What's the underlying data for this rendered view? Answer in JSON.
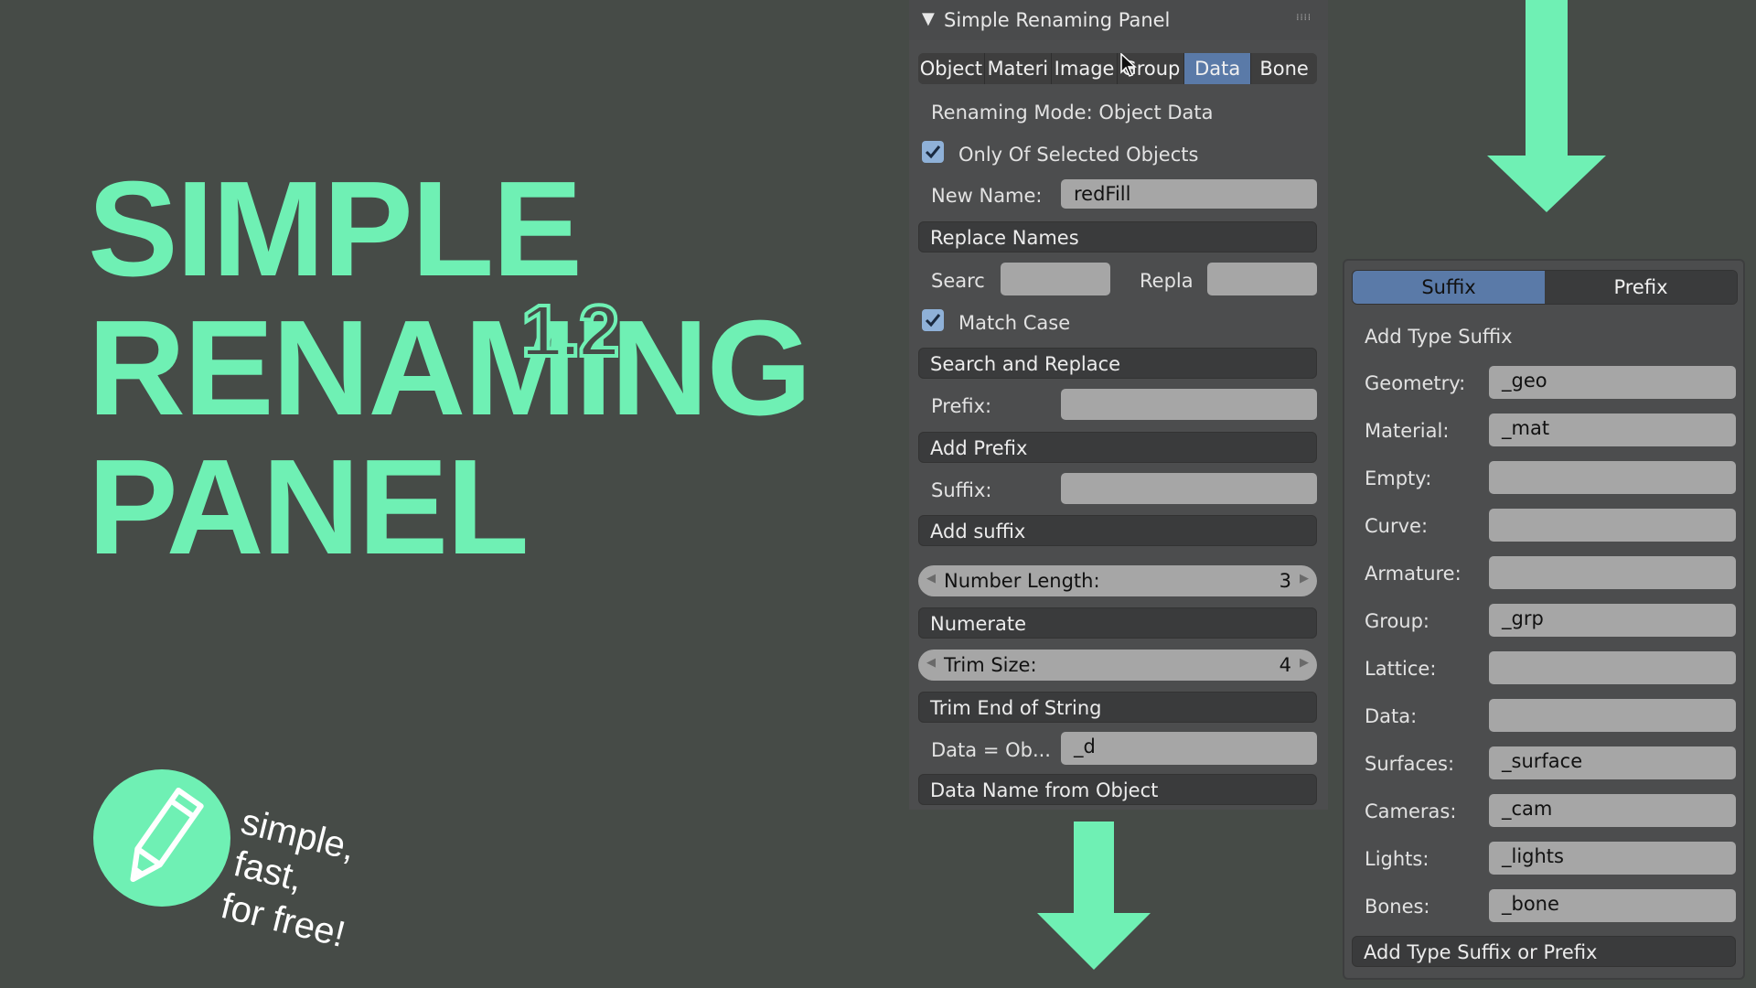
{
  "hero": {
    "line1": "SIMPLE",
    "line2": "RENAMING",
    "line3": "PANEL",
    "version": "1.2"
  },
  "logo": {
    "icon": "pencil-icon",
    "tagline1": "simple,",
    "tagline2": "fast,",
    "tagline3": "for free!"
  },
  "colors": {
    "accent": "#6ff0b4",
    "background": "#464b47",
    "panel": "#4c4d4e",
    "active_tab": "#5a7aa8",
    "field": "#a6a6a6",
    "button": "#3a3b3c"
  },
  "main_panel": {
    "title": "Simple Renaming Panel",
    "tabs": [
      {
        "label": "Object",
        "active": false
      },
      {
        "label": "Materi",
        "active": false
      },
      {
        "label": "Image",
        "active": false
      },
      {
        "label": "Group",
        "active": false
      },
      {
        "label": "Data",
        "active": true
      },
      {
        "label": "Bone",
        "active": false
      }
    ],
    "renaming_mode": "Renaming Mode: Object Data",
    "only_selected_label": "Only Of Selected Objects",
    "only_selected_checked": true,
    "new_name_label": "New Name:",
    "new_name_value": "redFill",
    "replace_names_button": "Replace Names",
    "search_label": "Searc",
    "search_value": "",
    "replace_label": "Repla",
    "replace_value": "",
    "match_case_label": "Match Case",
    "match_case_checked": true,
    "search_replace_button": "Search and Replace",
    "prefix_label": "Prefix:",
    "prefix_value": "",
    "add_prefix_button": "Add Prefix",
    "suffix_label": "Suffix:",
    "suffix_value": "",
    "add_suffix_button": "Add suffix",
    "number_length_label": "Number Length:",
    "number_length_value": "3",
    "numerate_button": "Numerate",
    "trim_size_label": "Trim Size:",
    "trim_size_value": "4",
    "trim_end_button": "Trim End of String",
    "data_ob_label": "Data = Ob...",
    "data_ob_value": "_d",
    "data_name_button": "Data Name from Object"
  },
  "right_panel": {
    "segments": [
      {
        "label": "Suffix",
        "active": true
      },
      {
        "label": "Prefix",
        "active": false
      }
    ],
    "heading": "Add Type Suffix",
    "rows": [
      {
        "label": "Geometry:",
        "value": "_geo"
      },
      {
        "label": "Material:",
        "value": "_mat"
      },
      {
        "label": "Empty:",
        "value": ""
      },
      {
        "label": "Curve:",
        "value": ""
      },
      {
        "label": "Armature:",
        "value": ""
      },
      {
        "label": "Group:",
        "value": "_grp"
      },
      {
        "label": "Lattice:",
        "value": ""
      },
      {
        "label": "Data:",
        "value": ""
      },
      {
        "label": "Surfaces:",
        "value": "_surface"
      },
      {
        "label": "Cameras:",
        "value": "_cam"
      },
      {
        "label": "Lights:",
        "value": "_lights"
      },
      {
        "label": "Bones:",
        "value": "_bone"
      }
    ],
    "apply_button": "Add Type Suffix or Prefix"
  }
}
